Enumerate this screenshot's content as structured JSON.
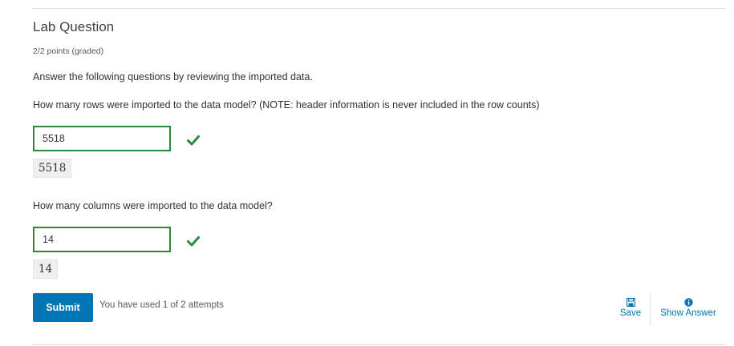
{
  "problem": {
    "title": "Lab Question",
    "points": "2/2 points (graded)",
    "intro": "Answer the following questions by reviewing the imported data."
  },
  "questions": [
    {
      "prompt": "How many rows were imported to the data model? (NOTE: header information is never included in the row counts)",
      "answer_value": "5518",
      "preview": "5518",
      "status": "correct"
    },
    {
      "prompt": "How many columns were imported to the data model?",
      "answer_value": "14",
      "preview": "14",
      "status": "correct"
    }
  ],
  "actions": {
    "submit_label": "Submit",
    "attempts_text": "You have used 1 of 2 attempts",
    "save_label": "Save",
    "show_answer_label": "Show Answer"
  },
  "colors": {
    "accent": "#0075b4",
    "correct": "#2b8a3e"
  },
  "icons": {
    "save": "floppy-disk-icon",
    "show_answer": "info-circle-icon",
    "status": "checkmark-icon"
  }
}
